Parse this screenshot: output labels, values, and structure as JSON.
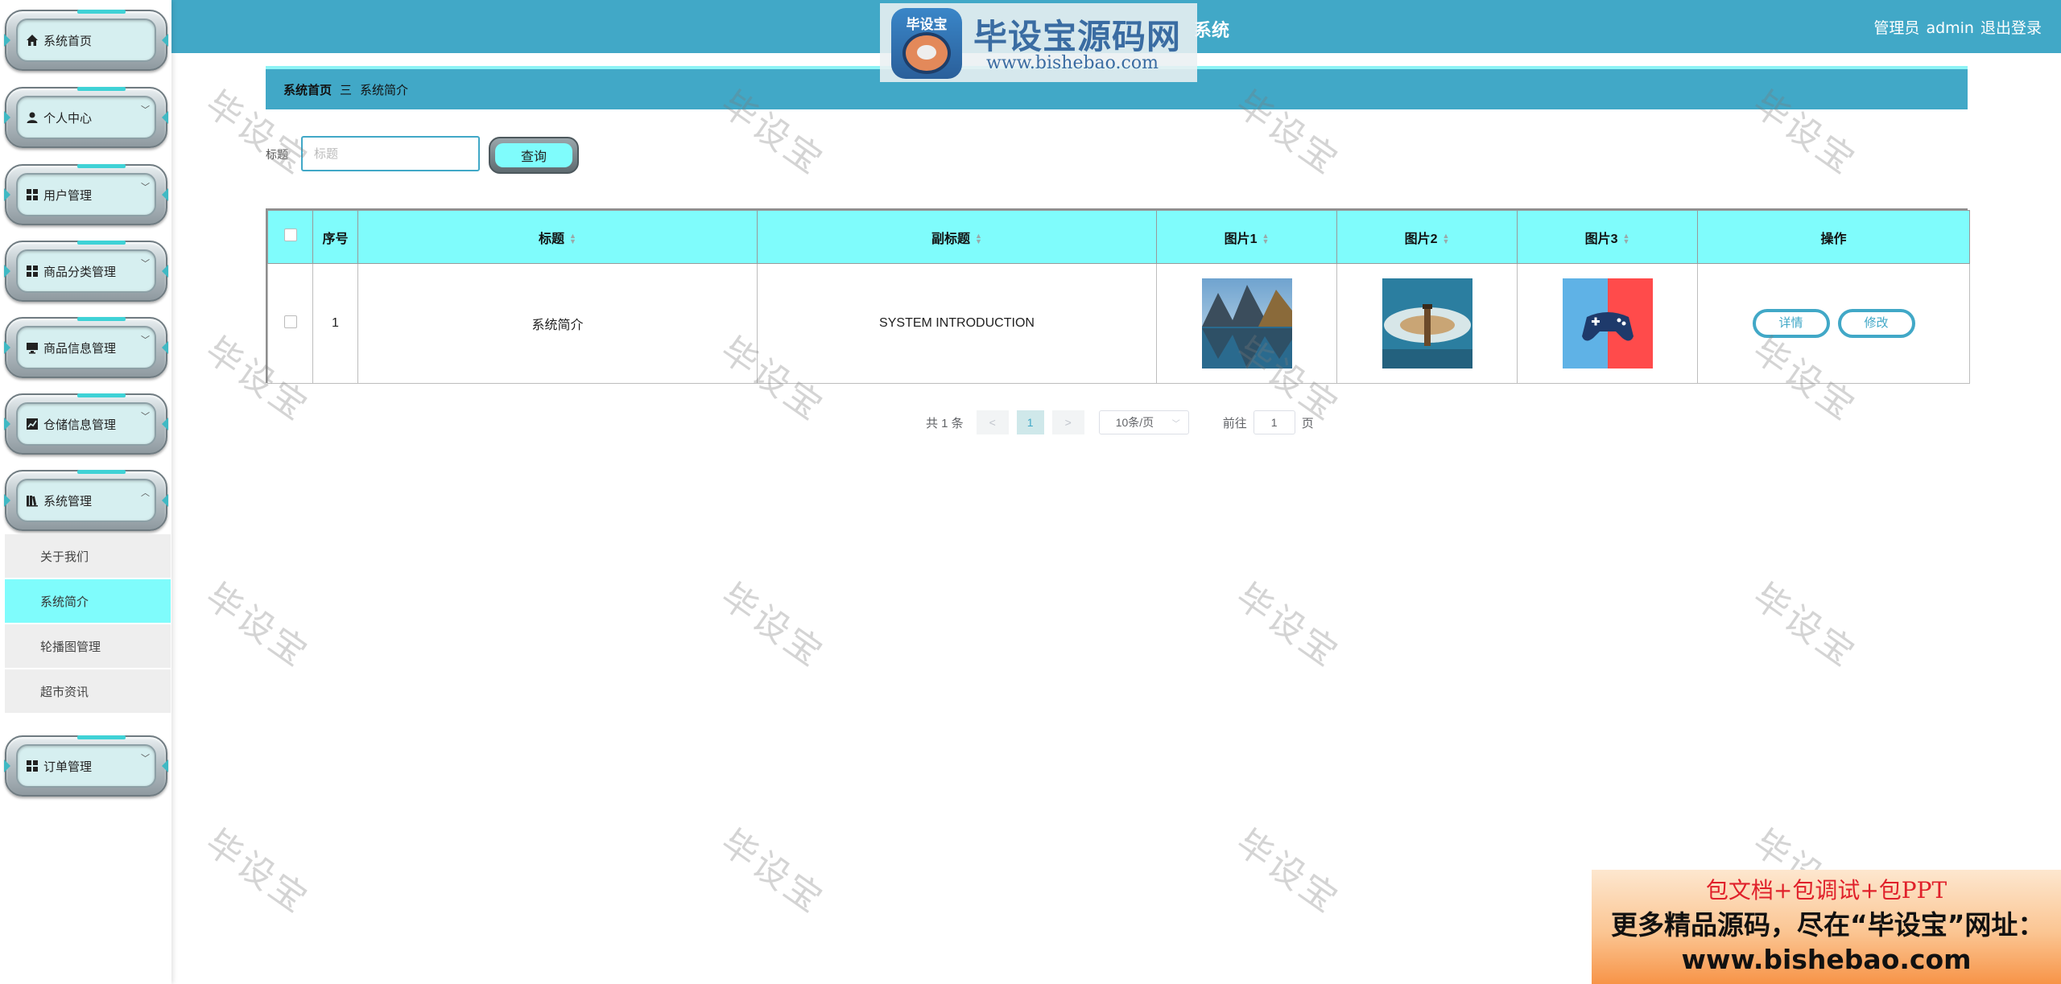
{
  "header": {
    "title": "系统",
    "user_role": "管理员",
    "user_name": "admin",
    "logout_label": "退出登录"
  },
  "logo_watermark": {
    "badge": "毕设宝",
    "main": "毕设宝源码网",
    "url": "www.bishebao.com"
  },
  "sidebar": {
    "items": [
      {
        "label": "系统首页",
        "icon": "home-icon"
      },
      {
        "label": "个人中心",
        "icon": "user-icon"
      },
      {
        "label": "用户管理",
        "icon": "grid-icon"
      },
      {
        "label": "商品分类管理",
        "icon": "grid-icon"
      },
      {
        "label": "商品信息管理",
        "icon": "monitor-icon"
      },
      {
        "label": "仓储信息管理",
        "icon": "chart-icon"
      },
      {
        "label": "系统管理",
        "icon": "library-icon"
      },
      {
        "label": "订单管理",
        "icon": "grid-icon"
      }
    ],
    "submenu": [
      {
        "label": "关于我们",
        "active": false
      },
      {
        "label": "系统简介",
        "active": true
      },
      {
        "label": "轮播图管理",
        "active": false
      },
      {
        "label": "超市资讯",
        "active": false
      }
    ]
  },
  "breadcrumb": {
    "home": "系统首页",
    "separator": "三",
    "current": "系统简介"
  },
  "search": {
    "label": "标题",
    "placeholder": "标题",
    "button_label": "查询"
  },
  "table": {
    "columns": [
      "序号",
      "标题",
      "副标题",
      "图片1",
      "图片2",
      "图片3",
      "操作"
    ],
    "rows": [
      {
        "index": "1",
        "title": "系统简介",
        "subtitle": "SYSTEM INTRODUCTION",
        "images": [
          "mountain-lake-image",
          "lighthouse-image",
          "gamepad-image"
        ],
        "actions": [
          "详情",
          "修改"
        ]
      }
    ]
  },
  "pagination": {
    "total": "共 1 条",
    "prev": "<",
    "current_page": "1",
    "next": ">",
    "page_size": "10条/页",
    "goto_prefix": "前往",
    "goto_value": "1",
    "goto_suffix": "页"
  },
  "watermark_text": "毕设宝",
  "ad_banner": {
    "line1": "包文档+包调试+包PPT",
    "line2": "更多精品源码，尽在“毕设宝”网址：",
    "line3": "www.bishebao.com"
  },
  "colors": {
    "primary": "#41a8c7",
    "accent_cyan": "#7ffcfc",
    "sidebar_active": "#7ffcfc"
  }
}
